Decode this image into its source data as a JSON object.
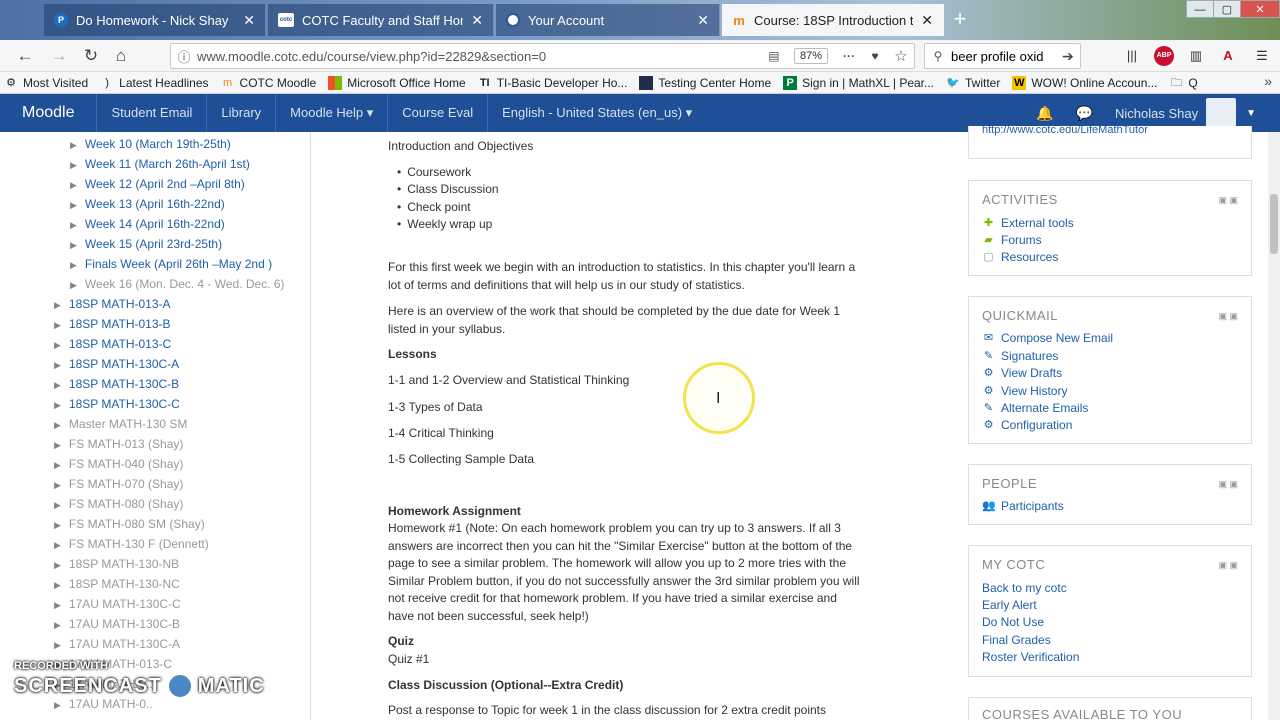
{
  "browser": {
    "tabs": [
      {
        "label": "Do Homework - Nick Shay",
        "icon": "pearson-p-icon"
      },
      {
        "label": "COTC Faculty and Staff Home",
        "icon": "cotc-logo-icon"
      },
      {
        "label": "Your Account",
        "icon": "account-globe-icon"
      },
      {
        "label": "Course: 18SP Introduction to St",
        "icon": "moodle-icon"
      }
    ],
    "url": "www.moodle.cotc.edu/course/view.php?id=22829&section=0",
    "zoom": "87%",
    "search_value": "beer profile oxid",
    "bookmarks": [
      "Most Visited",
      "Latest Headlines",
      "COTC Moodle",
      "Microsoft Office Home",
      "TI-Basic Developer Ho...",
      "Testing Center Home",
      "Sign in | MathXL | Pear...",
      "Twitter",
      "WOW! Online Accoun...",
      "Q"
    ]
  },
  "moodle_nav": {
    "brand": "Moodle",
    "items": [
      "Student Email",
      "Library",
      "Moodle Help ▾",
      "Course Eval",
      "English - United States (en_us) ▾"
    ],
    "user": "Nicholas Shay"
  },
  "left_nav": {
    "weeks": [
      "Week 10 (March 19th-25th)",
      "Week 11 (March 26th-April 1st)",
      "Week 12 (April 2nd –April 8th)",
      "Week 13 (April 16th-22nd)",
      "Week 14 (April 16th-22nd)",
      "Week 15 (April 23rd-25th)",
      "Finals Week (April 26th –May 2nd )",
      "Week 16 (Mon. Dec. 4 - Wed. Dec. 6)"
    ],
    "courses_active": [
      "18SP MATH-013-A",
      "18SP MATH-013-B",
      "18SP MATH-013-C",
      "18SP MATH-130C-A",
      "18SP MATH-130C-B",
      "18SP MATH-130C-C"
    ],
    "courses_dim": [
      "Master MATH-130 SM",
      "FS MATH-013 (Shay)",
      "FS MATH-040 (Shay)",
      "FS MATH-070 (Shay)",
      "FS MATH-080 (Shay)",
      "FS MATH-080 SM (Shay)",
      "FS MATH-130 F (Dennett)",
      "18SP MATH-130-NB",
      "18SP MATH-130-NC",
      "17AU MATH-130C-C",
      "17AU MATH-130C-B",
      "17AU MATH-130C-A",
      "17AU MATH-013-C",
      "17AU MATH-0..",
      "17AU MATH-0.."
    ]
  },
  "content": {
    "intro_heading": "Introduction and Objectives",
    "objectives": [
      "Coursework",
      "Class Discussion",
      "Check point",
      "Weekly wrap up"
    ],
    "para1": "For this first week we begin with an introduction to statistics. In this chapter you'll learn a lot of terms and definitions that will help us in our study of statistics.",
    "para2": "Here is an overview of the work that should be completed by the due date for Week 1 listed in your syllabus.",
    "lessons_heading": "Lessons",
    "lessons": [
      "1-1 and 1-2 Overview and Statistical Thinking",
      "1-3 Types of Data",
      "1-4 Critical Thinking",
      "1-5 Collecting Sample Data"
    ],
    "hw_heading": "Homework Assignment",
    "hw_text": "Homework #1 (Note: On each homework problem you can try up to 3 answers. If all 3 answers are incorrect then you can hit the \"Similar Exercise\" button at the bottom of the page to see a similar problem. The homework will allow you up to 2 more tries with the Similar Problem button, if you do not successfully answer the 3rd similar problem you will not receive credit for that homework problem. If you have tried a similar exercise and have not been successful, seek help!)",
    "quiz_heading": "Quiz",
    "quiz_text": "Quiz #1",
    "discussion_heading": "Class Discussion (Optional--Extra Credit)",
    "discussion_text": "Post a response to Topic for week 1 in the class discussion for 2 extra credit points"
  },
  "blocks": {
    "top_link": "http://www.cotc.edu/LifeMathTutor",
    "activities": {
      "title": "ACTIVITIES",
      "items": [
        "External tools",
        "Forums",
        "Resources"
      ]
    },
    "quickmail": {
      "title": "QUICKMAIL",
      "items": [
        "Compose New Email",
        "Signatures",
        "View Drafts",
        "View History",
        "Alternate Emails",
        "Configuration"
      ]
    },
    "people": {
      "title": "PEOPLE",
      "items": [
        "Participants"
      ]
    },
    "mycotc": {
      "title": "MY COTC",
      "items": [
        "Back to my cotc",
        "Early Alert",
        "Do Not Use",
        "Final Grades",
        "Roster Verification"
      ]
    },
    "courses": {
      "title": "COURSES AVAILABLE TO YOU"
    }
  },
  "watermark": {
    "recorded": "RECORDED WITH",
    "brand_left": "SCREENCAST",
    "brand_right": "MATIC"
  }
}
